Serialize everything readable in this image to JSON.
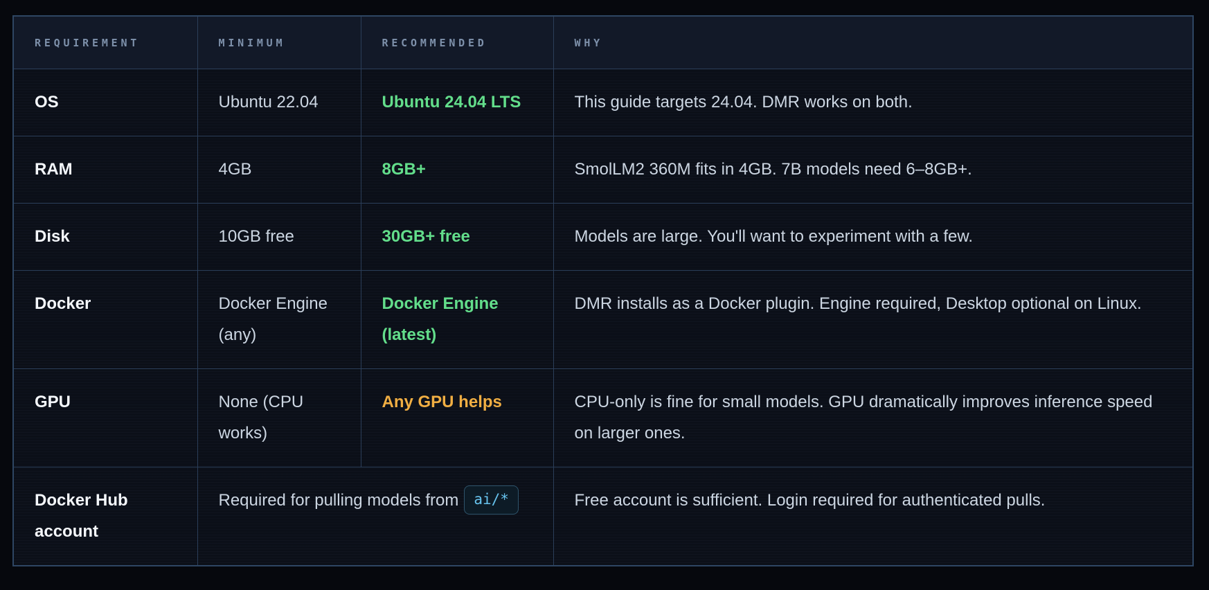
{
  "colors": {
    "green_accent": "#63de8b",
    "orange_accent": "#f0ae43",
    "code_text": "#67c3ee",
    "border": "#2b3e59",
    "header_text": "#7e91ab"
  },
  "table": {
    "headers": {
      "requirement": "REQUIREMENT",
      "minimum": "MINIMUM",
      "recommended": "RECOMMENDED",
      "why": "WHY"
    },
    "rows": [
      {
        "requirement": "OS",
        "minimum": "Ubuntu 22.04",
        "recommended": "Ubuntu 24.04 LTS",
        "recommended_color": "green",
        "why": "This guide targets 24.04. DMR works on both."
      },
      {
        "requirement": "RAM",
        "minimum": "4GB",
        "recommended": "8GB+",
        "recommended_color": "green",
        "why": "SmolLM2 360M fits in 4GB. 7B models need 6–8GB+."
      },
      {
        "requirement": "Disk",
        "minimum": "10GB free",
        "recommended": "30GB+ free",
        "recommended_color": "green",
        "why": "Models are large. You'll want to experiment with a few."
      },
      {
        "requirement": "Docker",
        "minimum": "Docker Engine (any)",
        "recommended": "Docker Engine (latest)",
        "recommended_color": "green",
        "why": "DMR installs as a Docker plugin. Engine required, Desktop optional on Linux."
      },
      {
        "requirement": "GPU",
        "minimum": "None (CPU works)",
        "recommended": "Any GPU helps",
        "recommended_color": "orange",
        "why": "CPU-only is fine for small models. GPU dramatically improves inference speed on larger ones."
      },
      {
        "requirement": "Docker Hub account",
        "spanned_text": "Required for pulling models from",
        "spanned_code": "ai/*",
        "why": "Free account is sufficient. Login required for authenticated pulls."
      }
    ]
  }
}
